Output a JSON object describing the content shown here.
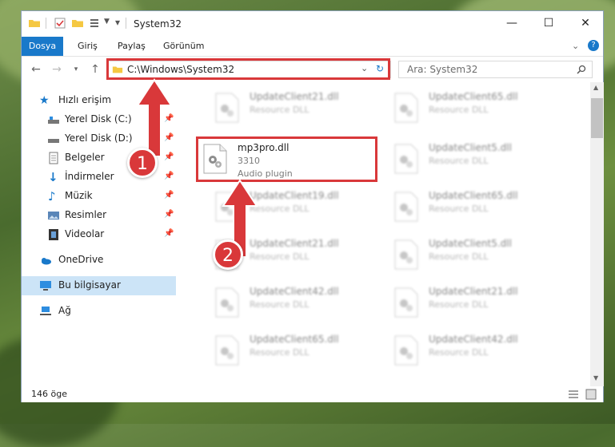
{
  "window": {
    "title": "System32",
    "controls": {
      "minimize": "—",
      "maximize": "☐",
      "close": "✕"
    }
  },
  "ribbon": {
    "tabs": [
      "Dosya",
      "Giriş",
      "Paylaş",
      "Görünüm"
    ]
  },
  "nav": {
    "address": "C:\\Windows\\System32",
    "search_placeholder": "Ara: System32"
  },
  "sidebar": {
    "items": [
      {
        "label": "Hızlı erişim",
        "icon": "star-icon",
        "pinned": false
      },
      {
        "label": "Yerel Disk (C:)",
        "icon": "drive-icon",
        "pinned": true
      },
      {
        "label": "Yerel Disk (D:)",
        "icon": "drive-icon",
        "pinned": true
      },
      {
        "label": "Belgeler",
        "icon": "document-icon",
        "pinned": true
      },
      {
        "label": "İndirmeler",
        "icon": "download-icon",
        "pinned": true
      },
      {
        "label": "Müzik",
        "icon": "music-icon",
        "pinned": true
      },
      {
        "label": "Resimler",
        "icon": "pictures-icon",
        "pinned": true
      },
      {
        "label": "Videolar",
        "icon": "video-icon",
        "pinned": true
      },
      {
        "label": "OneDrive",
        "icon": "cloud-icon",
        "pinned": false
      },
      {
        "label": "Bu bilgisayar",
        "icon": "computer-icon",
        "pinned": false,
        "selected": true
      },
      {
        "label": "Ağ",
        "icon": "network-icon",
        "pinned": false
      }
    ]
  },
  "files": {
    "left": [
      {
        "name": "UpdateClient21.dll",
        "type": "Resource DLL"
      },
      {
        "name": "mp3pro.dll",
        "type": "3310",
        "type2": "Audio plugin"
      },
      {
        "name": "UpdateClient19.dll",
        "type": "Resource DLL"
      },
      {
        "name": "UpdateClient21.dll",
        "type": "Resource DLL"
      },
      {
        "name": "UpdateClient42.dll",
        "type": "Resource DLL"
      },
      {
        "name": "UpdateClient65.dll",
        "type": "Resource DLL"
      }
    ],
    "right": [
      {
        "name": "UpdateClient65.dll",
        "type": "Resource DLL"
      },
      {
        "name": "UpdateClient5.dll",
        "type": "Resource DLL"
      },
      {
        "name": "UpdateClient65.dll",
        "type": "Resource DLL"
      },
      {
        "name": "UpdateClient5.dll",
        "type": "Resource DLL"
      },
      {
        "name": "UpdateClient21.dll",
        "type": "Resource DLL"
      },
      {
        "name": "UpdateClient42.dll",
        "type": "Resource DLL"
      }
    ]
  },
  "status": {
    "count": "146 öge"
  },
  "annotations": {
    "step1": "1",
    "step2": "2"
  },
  "colors": {
    "accent": "#1979ca",
    "highlight": "#d9383a"
  }
}
